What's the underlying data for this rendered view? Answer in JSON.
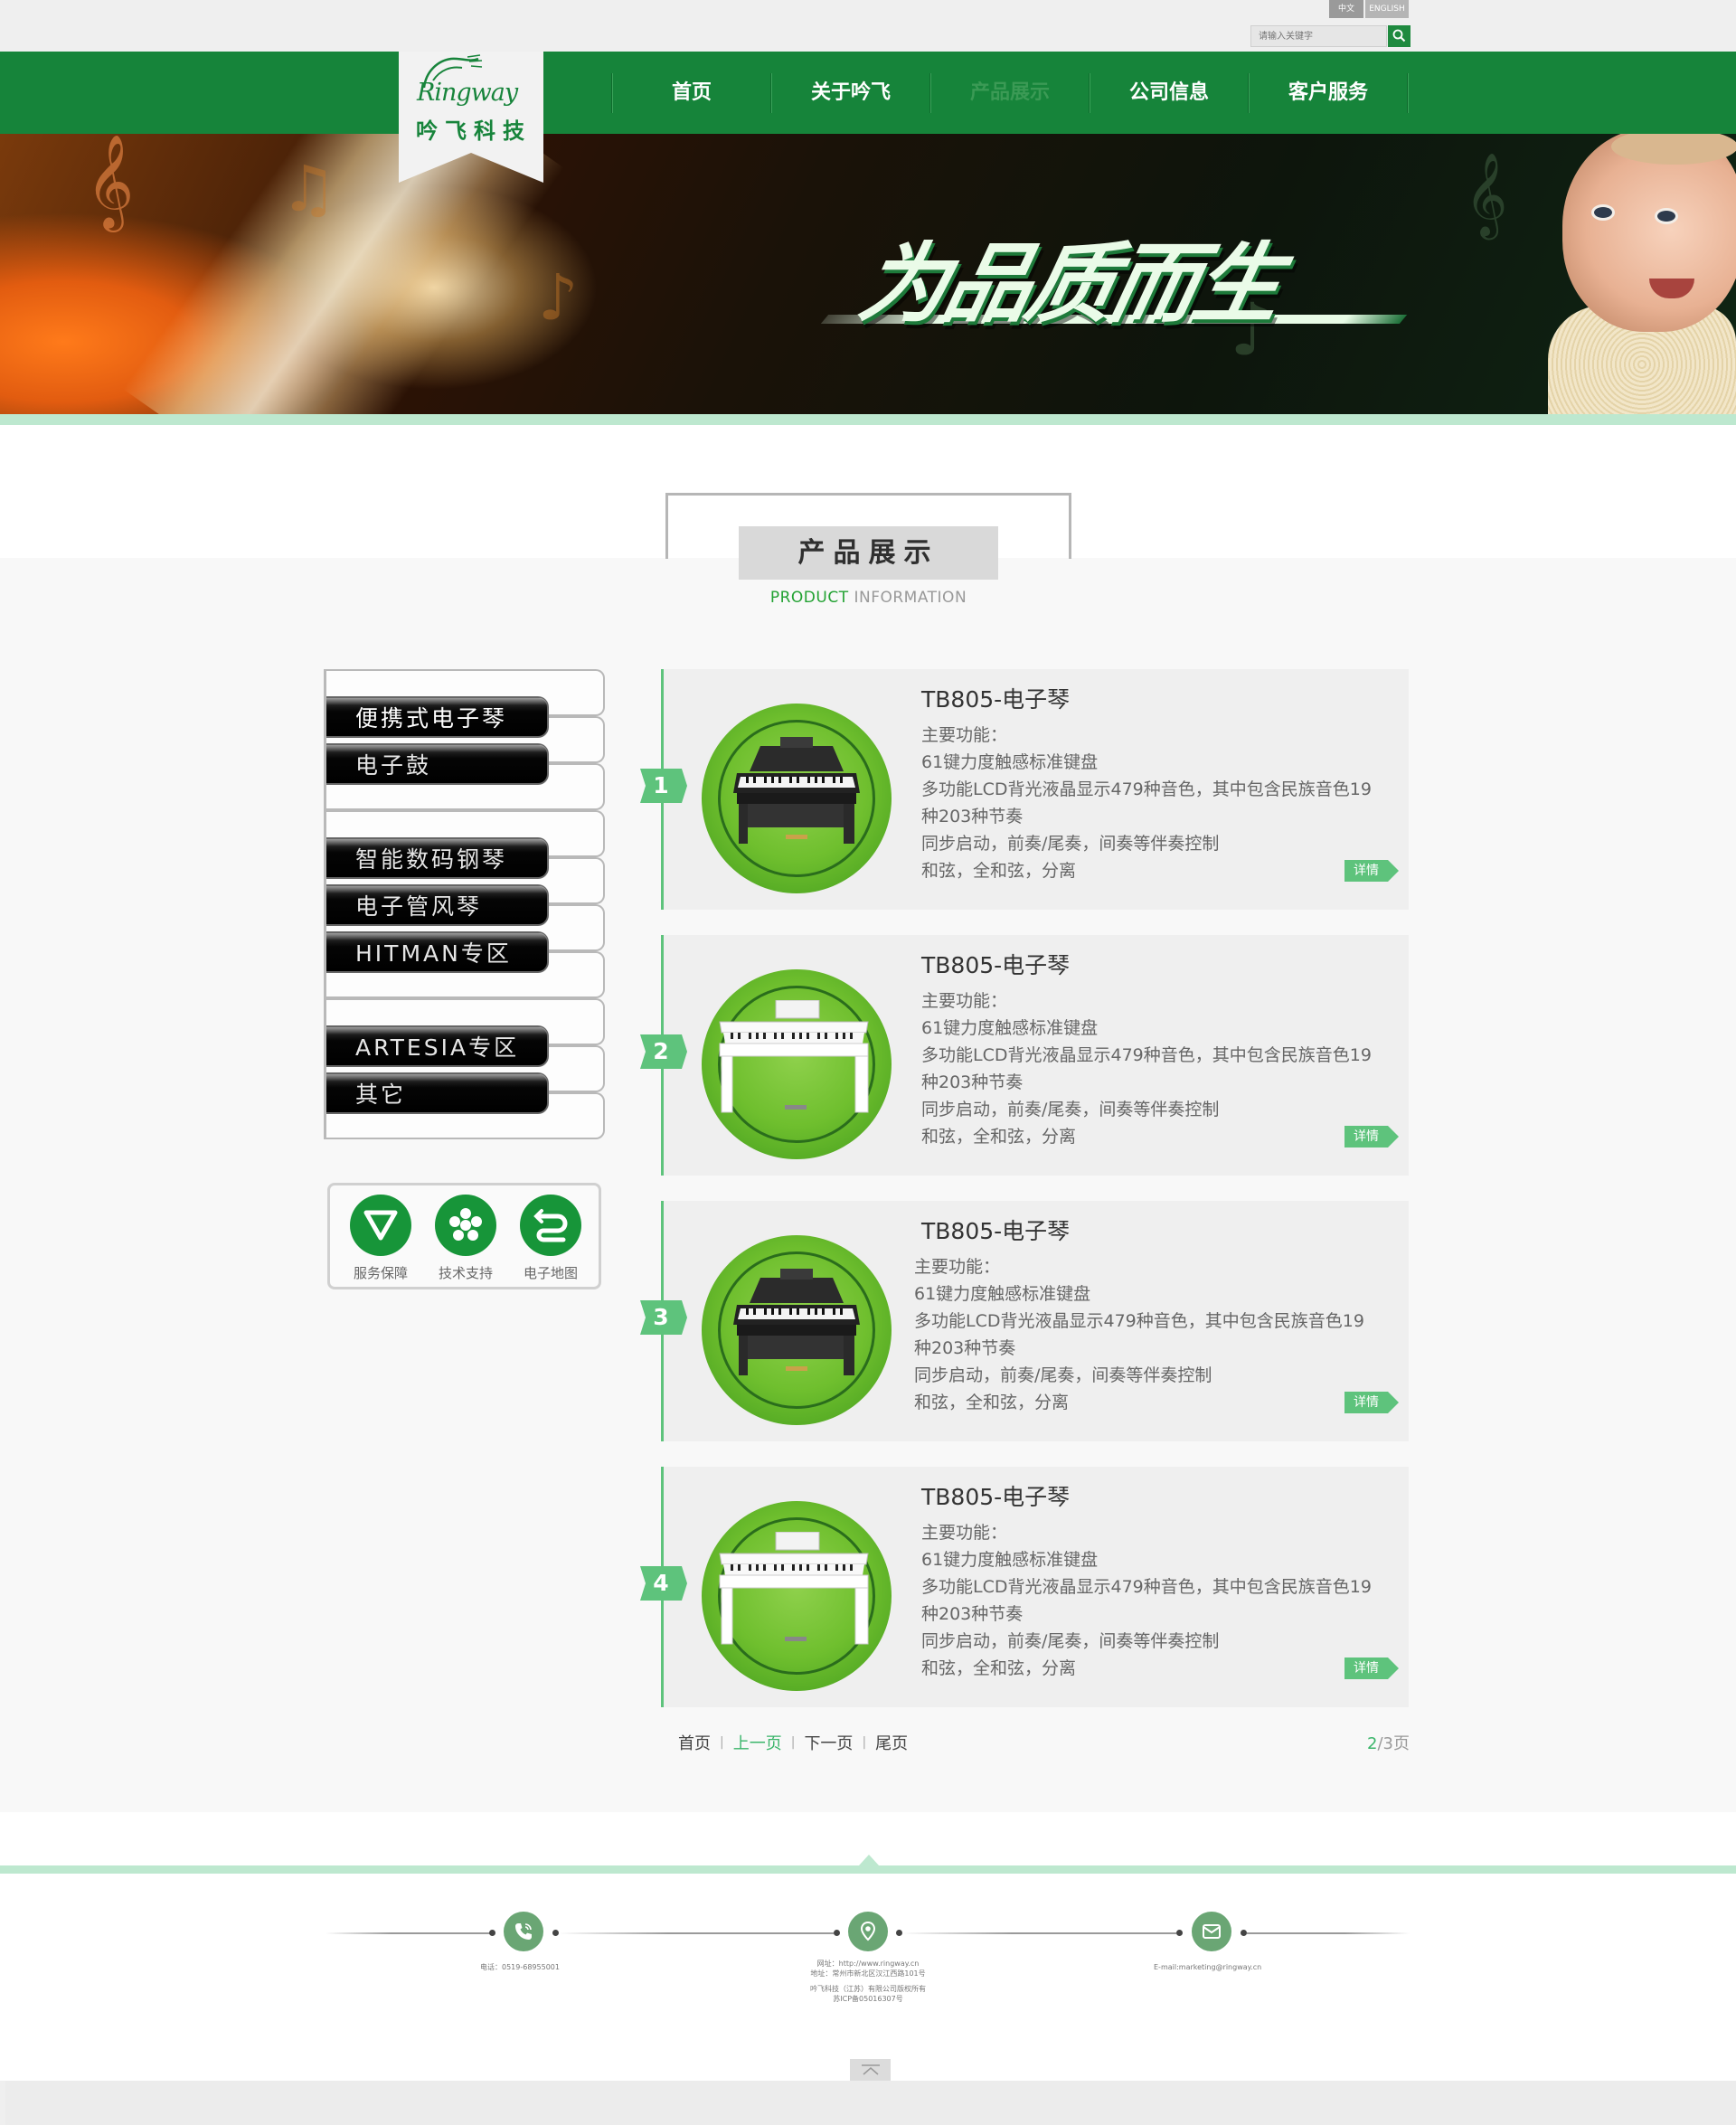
{
  "topbar": {
    "lang_zh": "中文",
    "lang_en": "ENGLISH",
    "search_placeholder": "请输入关键字"
  },
  "logo": {
    "script": "Ringway",
    "name_cn": "吟飞科技"
  },
  "nav": {
    "items": [
      {
        "label": "首页",
        "active": false
      },
      {
        "label": "关于吟飞",
        "active": false
      },
      {
        "label": "产品展示",
        "active": true
      },
      {
        "label": "公司信息",
        "active": false
      },
      {
        "label": "客户服务",
        "active": false
      }
    ]
  },
  "banner": {
    "slogan": "为品质而生"
  },
  "section": {
    "title": "产品展示",
    "sub_green": "PRODUCT",
    "sub_gray": " INFORMATION"
  },
  "sidebar": {
    "categories": [
      "便携式电子琴",
      "电子鼓",
      "智能数码钢琴",
      "电子管风琴",
      "HITMAN专区",
      "ARTESIA专区",
      "其它"
    ],
    "active_index": 0
  },
  "services": [
    {
      "label": "服务保障",
      "icon": "triangle-down-icon"
    },
    {
      "label": "技术支持",
      "icon": "asterisk-icon"
    },
    {
      "label": "电子地图",
      "icon": "map-route-icon"
    }
  ],
  "products": [
    {
      "num": "1",
      "name": "TB805-电子琴",
      "color": "black",
      "lines": [
        "主要功能：",
        "61键力度触感标准键盘",
        "多功能LCD背光液晶显示479种音色，其中包含民族音色19",
        "种203种节奏",
        "同步启动，前奏/尾奏，间奏等伴奏控制",
        "和弦，全和弦，分离"
      ],
      "more": "详情"
    },
    {
      "num": "2",
      "name": "TB805-电子琴",
      "color": "white",
      "lines": [
        "主要功能：",
        "61键力度触感标准键盘",
        "多功能LCD背光液晶显示479种音色，其中包含民族音色19",
        "种203种节奏",
        "同步启动，前奏/尾奏，间奏等伴奏控制",
        "和弦，全和弦，分离"
      ],
      "more": "详情"
    },
    {
      "num": "3",
      "name": "TB805-电子琴",
      "color": "black",
      "lines": [
        "主要功能：",
        "61键力度触感标准键盘",
        "多功能LCD背光液晶显示479种音色，其中包含民族音色19",
        "种203种节奏",
        "同步启动，前奏/尾奏，间奏等伴奏控制",
        "和弦，全和弦，分离"
      ],
      "more": "详情"
    },
    {
      "num": "4",
      "name": "TB805-电子琴",
      "color": "white",
      "lines": [
        "主要功能：",
        "61键力度触感标准键盘",
        "多功能LCD背光液晶显示479种音色，其中包含民族音色19",
        "种203种节奏",
        "同步启动，前奏/尾奏，间奏等伴奏控制",
        "和弦，全和弦，分离"
      ],
      "more": "详情"
    }
  ],
  "pager": {
    "first": "首页",
    "prev": "上一页",
    "next": "下一页",
    "last": "尾页",
    "current": "2",
    "total": "/3页"
  },
  "footer": {
    "phone": "电话：0519-68955001",
    "web": "网址：http://www.ringway.cn",
    "address": "地址：常州市新北区汉江西路101号",
    "copyright": "吟飞科技（江苏）有限公司版权所有",
    "icp": "苏ICP备05016307号",
    "email": "E-mail:marketing@ringway.cn"
  },
  "colors": {
    "brand_green": "#16843a",
    "accent_mint": "#bde8cf",
    "flag_green": "#5ec37c"
  }
}
